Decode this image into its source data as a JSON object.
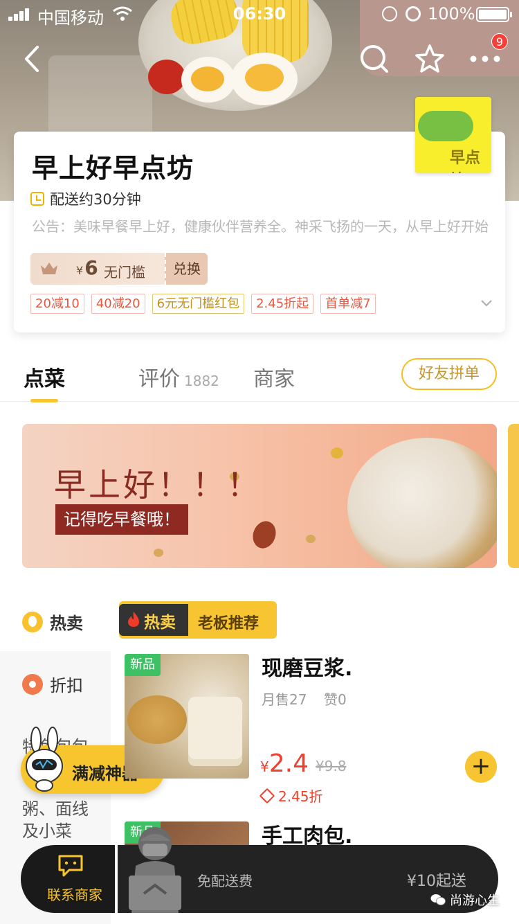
{
  "status_bar": {
    "carrier": "中国移动",
    "time": "06:30",
    "battery": "100%"
  },
  "nav": {
    "badge_count": "9",
    "icons": [
      "back-icon",
      "search-icon",
      "star-icon",
      "more-icon"
    ]
  },
  "shop": {
    "name": "早上好早点坊",
    "logo_text": "早点坊",
    "delivery_time": "配送约30分钟",
    "notice": "公告：美味早餐早上好，健康伙伴营养全。神采飞扬的一天，从早上好开始",
    "coupon": {
      "currency": "¥",
      "amount": "6",
      "condition": "无门槛",
      "redeem_label": "兑换"
    },
    "tags": [
      "20减10",
      "40减20",
      "6元无门槛红包",
      "2.45折起",
      "首单减7"
    ]
  },
  "tabs": {
    "order": "点菜",
    "review": "评价",
    "review_count": "1882",
    "merchant": "商家",
    "group_buy": "好友拼单"
  },
  "banner": {
    "title": "早上好！！！",
    "subtitle": "记得吃早餐哦！"
  },
  "categories": {
    "hot": "热卖",
    "discount": "折扣",
    "special": "特色包包",
    "porridge": "粥、面线及小菜"
  },
  "promo": {
    "label": "满减神器"
  },
  "section": {
    "hot_label": "热卖",
    "title": "老板推荐"
  },
  "products": [
    {
      "tag": "新品",
      "name": "现磨豆浆.",
      "sales": "月售27",
      "likes": "赞0",
      "currency": "¥",
      "price": "2.4",
      "old_price": "¥9.8",
      "discount": "2.45折"
    },
    {
      "tag": "新品",
      "name": "手工肉包."
    }
  ],
  "bottom_bar": {
    "contact": "联系商家",
    "free_delivery": "免配送费",
    "min_order": "¥10起送"
  },
  "watermark": "尚游心生",
  "colors": {
    "accent": "#f7c531",
    "price": "#f0402d",
    "new_tag": "#3ec065"
  }
}
